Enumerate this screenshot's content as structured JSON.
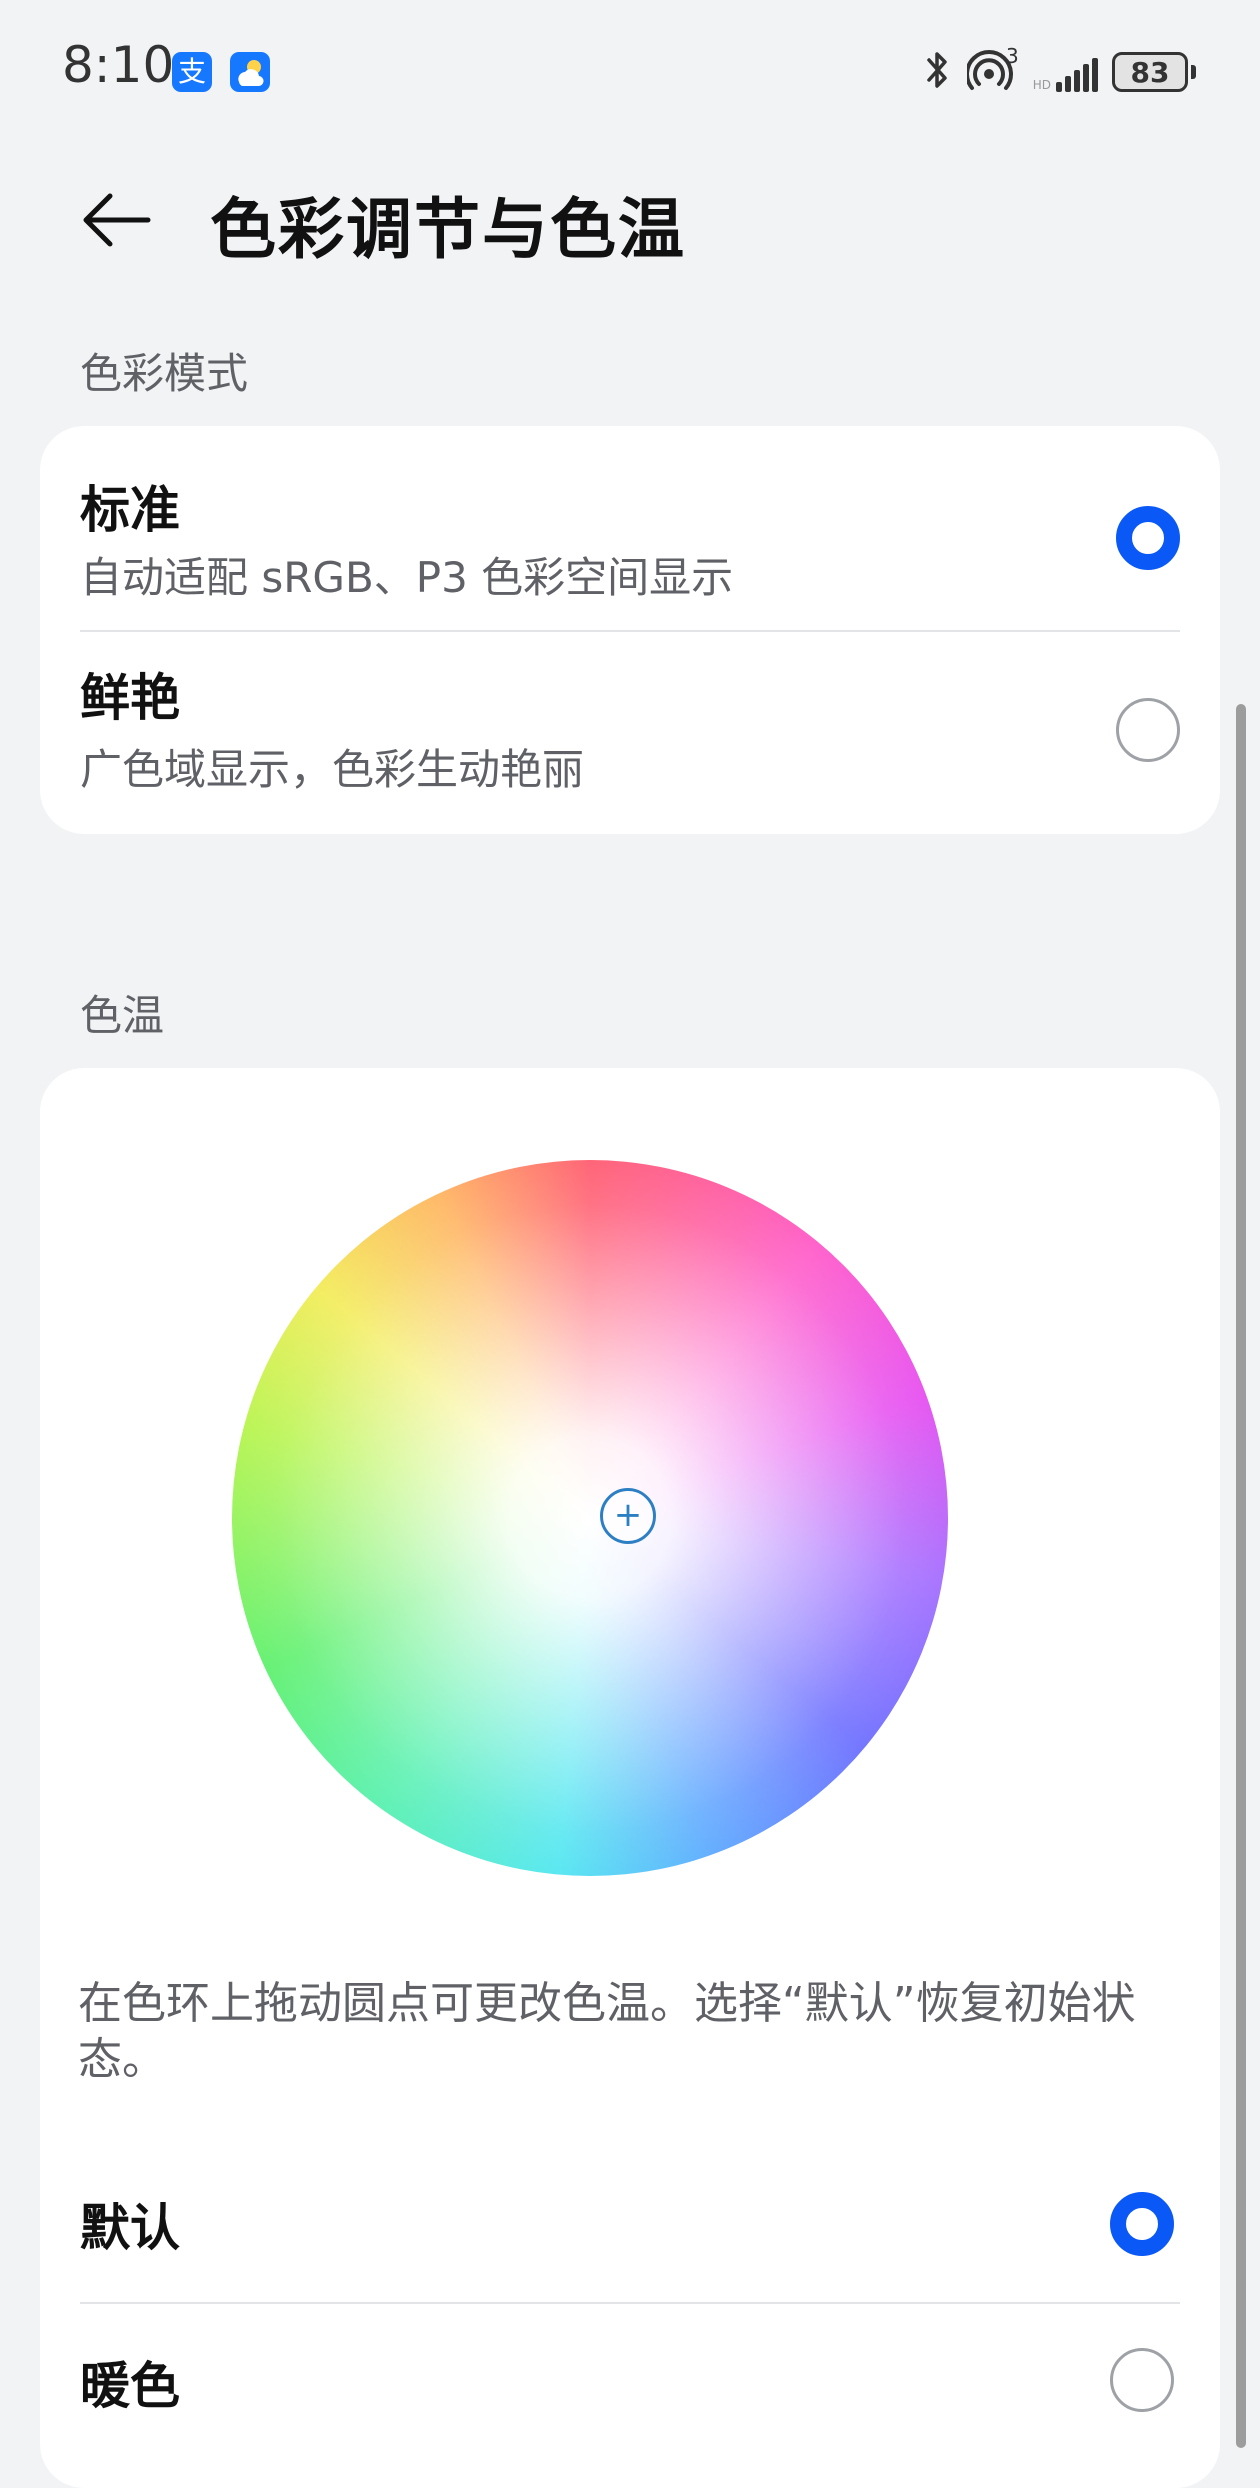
{
  "status_bar": {
    "time": "8:10",
    "app_icons": [
      "alipay-icon",
      "weather-icon"
    ],
    "alipay_glyph": "支",
    "network_superscript": "3",
    "signal_small_label": "HD",
    "battery_level": "83"
  },
  "header": {
    "title": "色彩调节与色温",
    "back_icon": "back-arrow-icon"
  },
  "color_mode": {
    "section_label": "色彩模式",
    "options": [
      {
        "title": "标准",
        "subtitle": "自动适配 sRGB、P3 色彩空间显示",
        "selected": true
      },
      {
        "title": "鲜艳",
        "subtitle": "广色域显示，色彩生动艳丽",
        "selected": false
      }
    ]
  },
  "color_temperature": {
    "section_label": "色温",
    "picker_symbol": "+",
    "hint": "在色环上拖动圆点可更改色温。选择“默认”恢复初始状态。",
    "options": [
      {
        "title": "默认",
        "selected": true
      },
      {
        "title": "暖色",
        "selected": false
      }
    ]
  },
  "colors": {
    "accent": "#0a59f7",
    "background": "#f1f3f5",
    "card": "#ffffff",
    "secondary_text": "#5f6166"
  }
}
